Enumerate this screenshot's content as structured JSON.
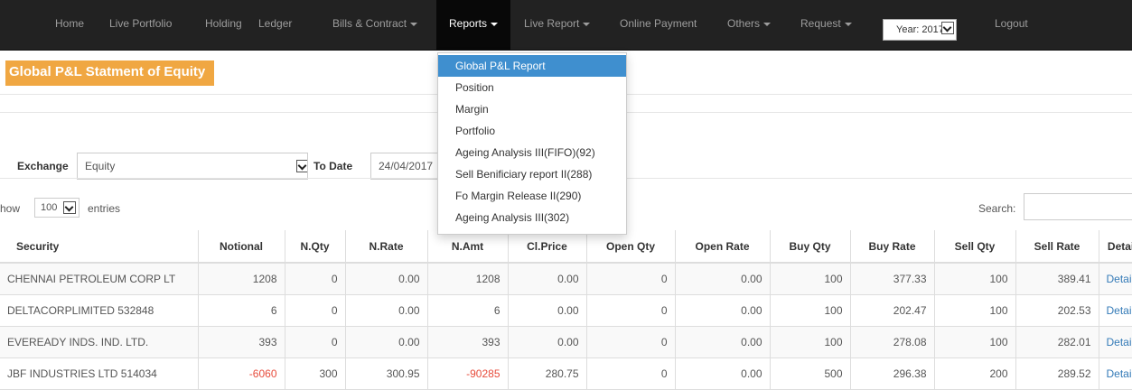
{
  "nav": {
    "items": [
      {
        "label": "Home",
        "caret": false
      },
      {
        "label": "Live Portfolio",
        "caret": false
      },
      {
        "label": "Holding",
        "caret": false
      },
      {
        "label": "Ledger",
        "caret": false
      },
      {
        "label": "Bills & Contract",
        "caret": true
      },
      {
        "label": "Reports",
        "caret": true,
        "active": true
      },
      {
        "label": "Live Report",
        "caret": true
      },
      {
        "label": "Online Payment",
        "caret": false
      },
      {
        "label": "Others",
        "caret": true
      },
      {
        "label": "Request",
        "caret": true
      },
      {
        "label": "Logout",
        "caret": false
      }
    ],
    "year_select": "Year: 2017"
  },
  "page_title": "Global P&L Statment of Equity",
  "filters": {
    "exchange_label": "Exchange",
    "exchange_value": "Equity",
    "todate_label": "To Date",
    "todate_value": "24/04/2017"
  },
  "table_controls": {
    "show_prefix": "how",
    "show_value": "100",
    "show_suffix": "entries",
    "search_label": "Search:"
  },
  "reports_menu": [
    "Global P&L Report",
    "Position",
    "Margin",
    "Portfolio",
    "Ageing Analysis III(FIFO)(92)",
    "Sell Benificiary report II(288)",
    "Fo Margin Release II(290)",
    "Ageing Analysis III(302)"
  ],
  "table": {
    "headers": [
      "Security",
      "Notional",
      "N.Qty",
      "N.Rate",
      "N.Amt",
      "Cl.Price",
      "Open Qty",
      "Open Rate",
      "Buy Qty",
      "Buy Rate",
      "Sell Qty",
      "Sell Rate",
      "Detail"
    ],
    "rows": [
      [
        "CHENNAI PETROLEUM CORP LT",
        "1208",
        "0",
        "0.00",
        "1208",
        "0.00",
        "0",
        "0.00",
        "100",
        "377.33",
        "100",
        "389.41",
        "Detail"
      ],
      [
        "DELTACORPLIMITED 532848",
        "6",
        "0",
        "0.00",
        "6",
        "0.00",
        "0",
        "0.00",
        "100",
        "202.47",
        "100",
        "202.53",
        "Detail"
      ],
      [
        "EVEREADY INDS. IND. LTD.",
        "393",
        "0",
        "0.00",
        "393",
        "0.00",
        "0",
        "0.00",
        "100",
        "278.08",
        "100",
        "282.01",
        "Detail"
      ],
      [
        "JBF INDUSTRIES LTD 514034",
        "-6060",
        "300",
        "300.95",
        "-90285",
        "280.75",
        "0",
        "0.00",
        "500",
        "296.38",
        "200",
        "289.52",
        "Detail"
      ]
    ]
  },
  "colors": {
    "navbar": "#222222",
    "title_badge": "#f0a742",
    "menu_highlight": "#3f8fcf",
    "negative": "#e74c3c",
    "link": "#337ab7"
  }
}
